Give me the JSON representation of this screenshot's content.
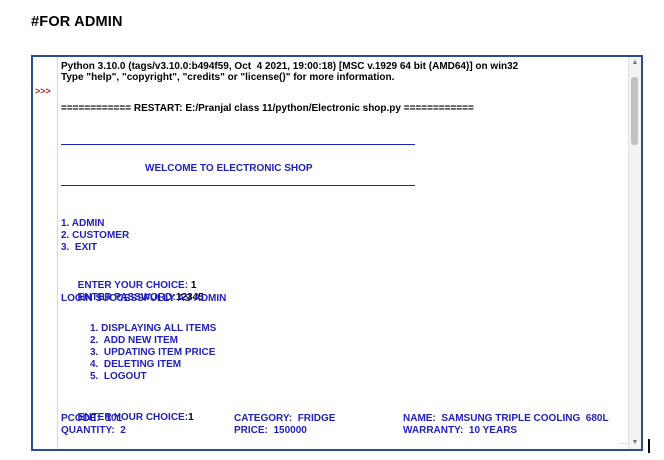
{
  "heading": "#FOR ADMIN",
  "prompt": ">>>",
  "header_lines": [
    "Python 3.10.0 (tags/v3.10.0:b494f59, Oct  4 2021, 19:00:18) [MSC v.1929 64 bit (AMD64)] on win32",
    "Type \"help\", \"copyright\", \"credits\" or \"license()\" for more information."
  ],
  "restart_line": "============ RESTART: E:/Pranjal class 11/python/Electronic shop.py ============",
  "welcome": "WELCOME TO ELECTRONIC SHOP",
  "main_menu": [
    "1. ADMIN",
    "2. CUSTOMER",
    "3.  EXIT"
  ],
  "choice_label": "ENTER YOUR CHOICE: ",
  "choice_value": "1",
  "password_label": "ENTER PASSWORD:",
  "password_value": "12345",
  "login_message": "LOGIN SUCCESSFULLY AS ADMIN",
  "admin_menu": [
    "1. DISPLAYING ALL ITEMS",
    "2.  ADD NEW ITEM",
    "3.  UPDATING ITEM PRICE",
    "4.  DELETING ITEM",
    "5.  LOGOUT"
  ],
  "choice2_label": "ENTER YOUR CHOICE:",
  "choice2_value": "1",
  "item_row1": {
    "pcode": "PCODE:  101",
    "category": "CATEGORY:  FRIDGE",
    "name": "NAME:  SAMSUNG TRIPLE COOLING  680L"
  },
  "item_row2": {
    "quantity": "QUANTITY:  2",
    "price": "PRICE:  150000",
    "warranty": "WARRANTY:  10 YEARS"
  },
  "colors": {
    "output_blue": "#1f1fbf",
    "prompt_red": "#b22222",
    "frame_blue": "#2a4d8f"
  }
}
